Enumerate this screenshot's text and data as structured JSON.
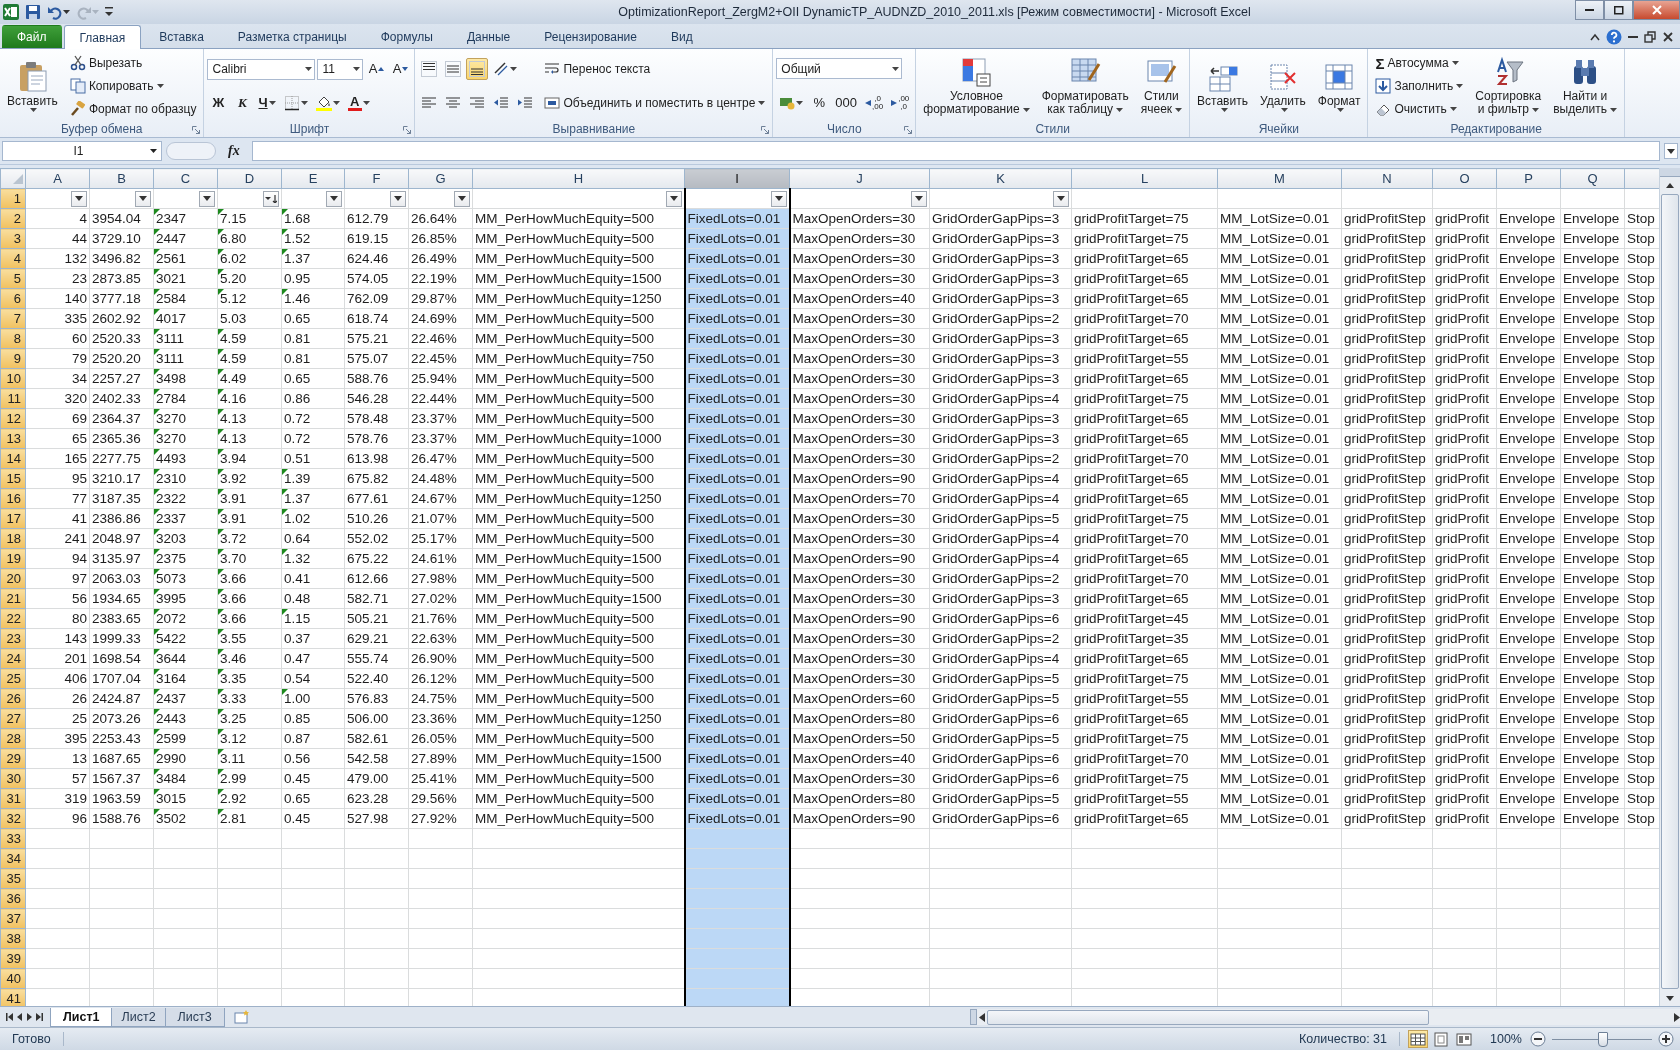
{
  "window": {
    "title": "OptimizationReport_ZergM2+OII DynamicTP_AUDNZD_2010_2011.xls  [Режим совместимости]  -  Microsoft Excel"
  },
  "quick_access": [
    {
      "disabled": false
    },
    {
      "disabled": false
    },
    {
      "disabled": true
    }
  ],
  "ribbon_tabs": [
    {
      "label": "Файл",
      "kind": "file",
      "selected": false
    },
    {
      "label": "Главная",
      "kind": "tab",
      "selected": true
    },
    {
      "label": "Вставка",
      "kind": "tab",
      "selected": false
    },
    {
      "label": "Разметка страницы",
      "kind": "tab",
      "selected": false
    },
    {
      "label": "Формулы",
      "kind": "tab",
      "selected": false
    },
    {
      "label": "Данные",
      "kind": "tab",
      "selected": false
    },
    {
      "label": "Рецензирование",
      "kind": "tab",
      "selected": false
    },
    {
      "label": "Вид",
      "kind": "tab",
      "selected": false
    }
  ],
  "ribbon": {
    "groups": [
      {
        "label": "Буфер обмена",
        "launcher": true,
        "columns": [
          [
            [
              {
                "kind": "large",
                "label": "Вставить",
                "dropdown": true
              }
            ]
          ],
          [
            [
              {
                "kind": "small",
                "label": "Вырезать"
              }
            ],
            [
              {
                "kind": "small",
                "label": "Копировать",
                "dropdown": true
              }
            ],
            [
              {
                "kind": "small",
                "label": "Формат по образцу"
              }
            ]
          ]
        ]
      },
      {
        "label": "Шрифт",
        "launcher": true,
        "columns": [
          [
            [
              {
                "kind": "combo",
                "value": "Calibri"
              },
              {
                "kind": "combo",
                "value": "11"
              },
              {
                "kind": "tool",
                "glyph": "A"
              },
              {
                "kind": "tool",
                "glyph": "A"
              }
            ],
            [
              {
                "kind": "tool",
                "glyph": "Ж"
              },
              {
                "kind": "tool",
                "glyph": "К"
              },
              {
                "kind": "tool",
                "glyph": "Ч",
                "dropdown": true
              },
              {
                "kind": "tool",
                "dropdown": true
              },
              {
                "kind": "tool",
                "dropdown": true
              },
              {
                "kind": "tool",
                "glyph": "A",
                "dropdown": true
              }
            ]
          ]
        ]
      },
      {
        "label": "Выравнивание",
        "launcher": true,
        "columns": [
          [
            [
              {
                "kind": "tool",
                "selected": false
              },
              {
                "kind": "tool",
                "selected": false
              },
              {
                "kind": "tool",
                "selected": true
              },
              {
                "kind": "tool",
                "dropdown": true
              }
            ],
            [
              {
                "kind": "tool",
                "selected": false
              },
              {
                "kind": "tool",
                "selected": false
              },
              {
                "kind": "tool",
                "selected": false
              },
              {
                "kind": "tool"
              },
              {
                "kind": "tool"
              }
            ]
          ],
          [
            [
              {
                "kind": "small",
                "label": "Перенос текста"
              }
            ],
            [
              {
                "kind": "small",
                "label": "Объединить и поместить в центре",
                "dropdown": true
              }
            ]
          ]
        ]
      },
      {
        "label": "Число",
        "launcher": true,
        "columns": [
          [
            [
              {
                "kind": "combo",
                "value": "Общий"
              }
            ],
            [
              {
                "kind": "tool",
                "dropdown": true
              },
              {
                "kind": "tool",
                "glyph": "%"
              },
              {
                "kind": "tool",
                "glyph": "000"
              },
              {
                "kind": "tool",
                "glyph": ",0\n,00"
              },
              {
                "kind": "tool",
                "glyph": ",00\n,0"
              }
            ]
          ]
        ]
      },
      {
        "label": "Стили",
        "launcher": false,
        "columns": [
          [
            [
              {
                "kind": "large",
                "label": "Условное\nформатирование",
                "dropdown": true
              }
            ]
          ],
          [
            [
              {
                "kind": "large",
                "label": "Форматировать\nкак таблицу",
                "dropdown": true
              }
            ]
          ],
          [
            [
              {
                "kind": "large",
                "label": "Стили\nячеек",
                "dropdown": true
              }
            ]
          ]
        ]
      },
      {
        "label": "Ячейки",
        "launcher": false,
        "columns": [
          [
            [
              {
                "kind": "large",
                "label": "Вставить",
                "dropdown": true
              }
            ]
          ],
          [
            [
              {
                "kind": "large",
                "label": "Удалить",
                "dropdown": true
              }
            ]
          ],
          [
            [
              {
                "kind": "large",
                "label": "Формат",
                "dropdown": true
              }
            ]
          ]
        ]
      },
      {
        "label": "Редактирование",
        "launcher": false,
        "columns": [
          [
            [
              {
                "kind": "small",
                "glyph": "Σ",
                "label": "Автосумма",
                "dropdown": true
              }
            ],
            [
              {
                "kind": "small",
                "label": "Заполнить",
                "dropdown": true
              }
            ],
            [
              {
                "kind": "small",
                "label": "Очистить",
                "dropdown": true
              }
            ]
          ],
          [
            [
              {
                "kind": "large",
                "label": "Сортировка\nи фильтр",
                "dropdown": true
              }
            ]
          ],
          [
            [
              {
                "kind": "large",
                "label": "Найти и\nвыделить",
                "dropdown": true
              }
            ]
          ]
        ]
      }
    ]
  },
  "formula_bar": {
    "name_box": "I1",
    "function_label": "fx"
  },
  "sheet": {
    "columns": [
      {
        "letter": "A",
        "kind": "number",
        "filter": true,
        "sorted_desc": false,
        "selected": false
      },
      {
        "letter": "B",
        "kind": "text",
        "filter": true,
        "sorted_desc": false,
        "selected": false
      },
      {
        "letter": "C",
        "kind": "text",
        "filter": true,
        "sorted_desc": false,
        "selected": false
      },
      {
        "letter": "D",
        "kind": "text",
        "filter": true,
        "sorted_desc": true,
        "selected": false
      },
      {
        "letter": "E",
        "kind": "text",
        "filter": true,
        "sorted_desc": false,
        "selected": false
      },
      {
        "letter": "F",
        "kind": "text",
        "filter": true,
        "sorted_desc": false,
        "selected": false
      },
      {
        "letter": "G",
        "kind": "text",
        "filter": true,
        "sorted_desc": false,
        "selected": false
      },
      {
        "letter": "H",
        "kind": "text",
        "filter": true,
        "sorted_desc": false,
        "selected": false
      },
      {
        "letter": "I",
        "kind": "text",
        "filter": true,
        "sorted_desc": false,
        "selected": true
      },
      {
        "letter": "J",
        "kind": "text",
        "filter": true,
        "sorted_desc": false,
        "selected": false
      },
      {
        "letter": "K",
        "kind": "text",
        "filter": true,
        "sorted_desc": false,
        "selected": false
      },
      {
        "letter": "L",
        "kind": "text",
        "filter": false,
        "selected": false
      },
      {
        "letter": "M",
        "kind": "text",
        "filter": false,
        "selected": false
      },
      {
        "letter": "N",
        "kind": "text",
        "filter": false,
        "selected": false
      },
      {
        "letter": "O",
        "kind": "text",
        "filter": false,
        "selected": false
      },
      {
        "letter": "P",
        "kind": "text",
        "filter": false,
        "selected": false
      },
      {
        "letter": "Q",
        "kind": "text",
        "filter": false,
        "selected": false
      },
      {
        "kind": "text",
        "filter": false,
        "selected": false
      }
    ],
    "row_numbers": [
      "1",
      "2",
      "3",
      "4",
      "5",
      "6",
      "7",
      "8",
      "9",
      "10",
      "11",
      "12",
      "13",
      "14",
      "15",
      "16",
      "17",
      "18",
      "19",
      "20",
      "21",
      "22",
      "23",
      "24",
      "25",
      "26",
      "27",
      "28",
      "29",
      "30",
      "31",
      "32",
      "33",
      "34",
      "35",
      "36",
      "37",
      "38",
      "39",
      "40",
      "41"
    ],
    "rows": [
      {
        "cells": [
          "4",
          "3954.04",
          "2347",
          "7.15",
          "1.68",
          "612.79",
          "26.64%",
          "MM_PerHowMuchEquity=500",
          "FixedLots=0.01",
          "MaxOpenOrders=30",
          "GridOrderGapPips=3",
          "gridProfitTarget=75",
          "MM_LotSize=0.01",
          "gridProfitStep",
          "gridProfit",
          "Envelope",
          "Envelope",
          "Stop"
        ],
        "marked": [
          true,
          true,
          true
        ]
      },
      {
        "cells": [
          "44",
          "3729.10",
          "2447",
          "6.80",
          "1.52",
          "619.15",
          "26.85%",
          "MM_PerHowMuchEquity=500",
          "FixedLots=0.01",
          "MaxOpenOrders=30",
          "GridOrderGapPips=3",
          "gridProfitTarget=75",
          "MM_LotSize=0.01",
          "gridProfitStep",
          "gridProfit",
          "Envelope",
          "Envelope",
          "Stop"
        ],
        "marked": [
          true,
          true,
          true
        ]
      },
      {
        "cells": [
          "132",
          "3496.82",
          "2561",
          "6.02",
          "1.37",
          "624.46",
          "26.49%",
          "MM_PerHowMuchEquity=500",
          "FixedLots=0.01",
          "MaxOpenOrders=30",
          "GridOrderGapPips=3",
          "gridProfitTarget=65",
          "MM_LotSize=0.01",
          "gridProfitStep",
          "gridProfit",
          "Envelope",
          "Envelope",
          "Stop"
        ],
        "marked": [
          true,
          true,
          true
        ]
      },
      {
        "cells": [
          "23",
          "2873.85",
          "3021",
          "5.20",
          "0.95",
          "574.05",
          "22.19%",
          "MM_PerHowMuchEquity=1500",
          "FixedLots=0.01",
          "MaxOpenOrders=30",
          "GridOrderGapPips=3",
          "gridProfitTarget=65",
          "MM_LotSize=0.01",
          "gridProfitStep",
          "gridProfit",
          "Envelope",
          "Envelope",
          "Stop"
        ],
        "marked": [
          true,
          true,
          false
        ]
      },
      {
        "cells": [
          "140",
          "3777.18",
          "2584",
          "5.12",
          "1.46",
          "762.09",
          "29.87%",
          "MM_PerHowMuchEquity=1250",
          "FixedLots=0.01",
          "MaxOpenOrders=40",
          "GridOrderGapPips=3",
          "gridProfitTarget=65",
          "MM_LotSize=0.01",
          "gridProfitStep",
          "gridProfit",
          "Envelope",
          "Envelope",
          "Stop"
        ],
        "marked": [
          true,
          true,
          true
        ]
      },
      {
        "cells": [
          "335",
          "2602.92",
          "4017",
          "5.03",
          "0.65",
          "618.74",
          "24.69%",
          "MM_PerHowMuchEquity=500",
          "FixedLots=0.01",
          "MaxOpenOrders=30",
          "GridOrderGapPips=2",
          "gridProfitTarget=70",
          "MM_LotSize=0.01",
          "gridProfitStep",
          "gridProfit",
          "Envelope",
          "Envelope",
          "Stop"
        ],
        "marked": [
          true,
          false,
          false
        ]
      },
      {
        "cells": [
          "60",
          "2520.33",
          "3111",
          "4.59",
          "0.81",
          "575.21",
          "22.46%",
          "MM_PerHowMuchEquity=500",
          "FixedLots=0.01",
          "MaxOpenOrders=30",
          "GridOrderGapPips=3",
          "gridProfitTarget=65",
          "MM_LotSize=0.01",
          "gridProfitStep",
          "gridProfit",
          "Envelope",
          "Envelope",
          "Stop"
        ],
        "marked": [
          true,
          true,
          false
        ]
      },
      {
        "cells": [
          "79",
          "2520.20",
          "3111",
          "4.59",
          "0.81",
          "575.07",
          "22.45%",
          "MM_PerHowMuchEquity=750",
          "FixedLots=0.01",
          "MaxOpenOrders=30",
          "GridOrderGapPips=3",
          "gridProfitTarget=55",
          "MM_LotSize=0.01",
          "gridProfitStep",
          "gridProfit",
          "Envelope",
          "Envelope",
          "Stop"
        ],
        "marked": [
          true,
          true,
          false
        ]
      },
      {
        "cells": [
          "34",
          "2257.27",
          "3498",
          "4.49",
          "0.65",
          "588.76",
          "25.94%",
          "MM_PerHowMuchEquity=500",
          "FixedLots=0.01",
          "MaxOpenOrders=30",
          "GridOrderGapPips=3",
          "gridProfitTarget=65",
          "MM_LotSize=0.01",
          "gridProfitStep",
          "gridProfit",
          "Envelope",
          "Envelope",
          "Stop"
        ],
        "marked": [
          true,
          true,
          false
        ]
      },
      {
        "cells": [
          "320",
          "2402.33",
          "2784",
          "4.16",
          "0.86",
          "546.28",
          "22.44%",
          "MM_PerHowMuchEquity=500",
          "FixedLots=0.01",
          "MaxOpenOrders=30",
          "GridOrderGapPips=4",
          "gridProfitTarget=75",
          "MM_LotSize=0.01",
          "gridProfitStep",
          "gridProfit",
          "Envelope",
          "Envelope",
          "Stop"
        ],
        "marked": [
          true,
          true,
          false
        ]
      },
      {
        "cells": [
          "69",
          "2364.37",
          "3270",
          "4.13",
          "0.72",
          "578.48",
          "23.37%",
          "MM_PerHowMuchEquity=500",
          "FixedLots=0.01",
          "MaxOpenOrders=30",
          "GridOrderGapPips=3",
          "gridProfitTarget=65",
          "MM_LotSize=0.01",
          "gridProfitStep",
          "gridProfit",
          "Envelope",
          "Envelope",
          "Stop"
        ],
        "marked": [
          true,
          true,
          false
        ]
      },
      {
        "cells": [
          "65",
          "2365.36",
          "3270",
          "4.13",
          "0.72",
          "578.76",
          "23.37%",
          "MM_PerHowMuchEquity=1000",
          "FixedLots=0.01",
          "MaxOpenOrders=30",
          "GridOrderGapPips=3",
          "gridProfitTarget=65",
          "MM_LotSize=0.01",
          "gridProfitStep",
          "gridProfit",
          "Envelope",
          "Envelope",
          "Stop"
        ],
        "marked": [
          true,
          true,
          false
        ]
      },
      {
        "cells": [
          "165",
          "2277.75",
          "4493",
          "3.94",
          "0.51",
          "613.98",
          "26.47%",
          "MM_PerHowMuchEquity=500",
          "FixedLots=0.01",
          "MaxOpenOrders=30",
          "GridOrderGapPips=2",
          "gridProfitTarget=70",
          "MM_LotSize=0.01",
          "gridProfitStep",
          "gridProfit",
          "Envelope",
          "Envelope",
          "Stop"
        ],
        "marked": [
          true,
          true,
          false
        ]
      },
      {
        "cells": [
          "95",
          "3210.17",
          "2310",
          "3.92",
          "1.39",
          "675.82",
          "24.48%",
          "MM_PerHowMuchEquity=500",
          "FixedLots=0.01",
          "MaxOpenOrders=90",
          "GridOrderGapPips=4",
          "gridProfitTarget=65",
          "MM_LotSize=0.01",
          "gridProfitStep",
          "gridProfit",
          "Envelope",
          "Envelope",
          "Stop"
        ],
        "marked": [
          true,
          true,
          true
        ]
      },
      {
        "cells": [
          "77",
          "3187.35",
          "2322",
          "3.91",
          "1.37",
          "677.61",
          "24.67%",
          "MM_PerHowMuchEquity=1250",
          "FixedLots=0.01",
          "MaxOpenOrders=70",
          "GridOrderGapPips=4",
          "gridProfitTarget=65",
          "MM_LotSize=0.01",
          "gridProfitStep",
          "gridProfit",
          "Envelope",
          "Envelope",
          "Stop"
        ],
        "marked": [
          true,
          true,
          true
        ]
      },
      {
        "cells": [
          "41",
          "2386.86",
          "2337",
          "3.91",
          "1.02",
          "510.26",
          "21.07%",
          "MM_PerHowMuchEquity=500",
          "FixedLots=0.01",
          "MaxOpenOrders=30",
          "GridOrderGapPips=5",
          "gridProfitTarget=75",
          "MM_LotSize=0.01",
          "gridProfitStep",
          "gridProfit",
          "Envelope",
          "Envelope",
          "Stop"
        ],
        "marked": [
          true,
          true,
          true
        ]
      },
      {
        "cells": [
          "241",
          "2048.97",
          "3203",
          "3.72",
          "0.64",
          "552.02",
          "25.17%",
          "MM_PerHowMuchEquity=500",
          "FixedLots=0.01",
          "MaxOpenOrders=30",
          "GridOrderGapPips=4",
          "gridProfitTarget=70",
          "MM_LotSize=0.01",
          "gridProfitStep",
          "gridProfit",
          "Envelope",
          "Envelope",
          "Stop"
        ],
        "marked": [
          true,
          true,
          false
        ]
      },
      {
        "cells": [
          "94",
          "3135.97",
          "2375",
          "3.70",
          "1.32",
          "675.22",
          "24.61%",
          "MM_PerHowMuchEquity=1500",
          "FixedLots=0.01",
          "MaxOpenOrders=90",
          "GridOrderGapPips=4",
          "gridProfitTarget=65",
          "MM_LotSize=0.01",
          "gridProfitStep",
          "gridProfit",
          "Envelope",
          "Envelope",
          "Stop"
        ],
        "marked": [
          true,
          true,
          true
        ]
      },
      {
        "cells": [
          "97",
          "2063.03",
          "5073",
          "3.66",
          "0.41",
          "612.66",
          "27.98%",
          "MM_PerHowMuchEquity=500",
          "FixedLots=0.01",
          "MaxOpenOrders=30",
          "GridOrderGapPips=2",
          "gridProfitTarget=70",
          "MM_LotSize=0.01",
          "gridProfitStep",
          "gridProfit",
          "Envelope",
          "Envelope",
          "Stop"
        ],
        "marked": [
          true,
          true,
          false
        ]
      },
      {
        "cells": [
          "56",
          "1934.65",
          "3995",
          "3.66",
          "0.48",
          "582.71",
          "27.02%",
          "MM_PerHowMuchEquity=1500",
          "FixedLots=0.01",
          "MaxOpenOrders=30",
          "GridOrderGapPips=3",
          "gridProfitTarget=65",
          "MM_LotSize=0.01",
          "gridProfitStep",
          "gridProfit",
          "Envelope",
          "Envelope",
          "Stop"
        ],
        "marked": [
          true,
          true,
          false
        ]
      },
      {
        "cells": [
          "80",
          "2383.65",
          "2072",
          "3.66",
          "1.15",
          "505.21",
          "21.76%",
          "MM_PerHowMuchEquity=500",
          "FixedLots=0.01",
          "MaxOpenOrders=90",
          "GridOrderGapPips=6",
          "gridProfitTarget=45",
          "MM_LotSize=0.01",
          "gridProfitStep",
          "gridProfit",
          "Envelope",
          "Envelope",
          "Stop"
        ],
        "marked": [
          true,
          true,
          true
        ]
      },
      {
        "cells": [
          "143",
          "1999.33",
          "5422",
          "3.55",
          "0.37",
          "629.21",
          "22.63%",
          "MM_PerHowMuchEquity=500",
          "FixedLots=0.01",
          "MaxOpenOrders=30",
          "GridOrderGapPips=2",
          "gridProfitTarget=35",
          "MM_LotSize=0.01",
          "gridProfitStep",
          "gridProfit",
          "Envelope",
          "Envelope",
          "Stop"
        ],
        "marked": [
          true,
          true,
          false
        ]
      },
      {
        "cells": [
          "201",
          "1698.54",
          "3644",
          "3.46",
          "0.47",
          "555.74",
          "26.90%",
          "MM_PerHowMuchEquity=500",
          "FixedLots=0.01",
          "MaxOpenOrders=30",
          "GridOrderGapPips=4",
          "gridProfitTarget=65",
          "MM_LotSize=0.01",
          "gridProfitStep",
          "gridProfit",
          "Envelope",
          "Envelope",
          "Stop"
        ],
        "marked": [
          true,
          true,
          false
        ]
      },
      {
        "cells": [
          "406",
          "1707.04",
          "3164",
          "3.35",
          "0.54",
          "522.40",
          "26.12%",
          "MM_PerHowMuchEquity=500",
          "FixedLots=0.01",
          "MaxOpenOrders=30",
          "GridOrderGapPips=5",
          "gridProfitTarget=75",
          "MM_LotSize=0.01",
          "gridProfitStep",
          "gridProfit",
          "Envelope",
          "Envelope",
          "Stop"
        ],
        "marked": [
          true,
          true,
          false
        ]
      },
      {
        "cells": [
          "26",
          "2424.87",
          "2437",
          "3.33",
          "1.00",
          "576.83",
          "24.75%",
          "MM_PerHowMuchEquity=500",
          "FixedLots=0.01",
          "MaxOpenOrders=60",
          "GridOrderGapPips=5",
          "gridProfitTarget=55",
          "MM_LotSize=0.01",
          "gridProfitStep",
          "gridProfit",
          "Envelope",
          "Envelope",
          "Stop"
        ],
        "marked": [
          true,
          true,
          true
        ]
      },
      {
        "cells": [
          "25",
          "2073.26",
          "2443",
          "3.25",
          "0.85",
          "506.00",
          "23.36%",
          "MM_PerHowMuchEquity=1250",
          "FixedLots=0.01",
          "MaxOpenOrders=80",
          "GridOrderGapPips=6",
          "gridProfitTarget=65",
          "MM_LotSize=0.01",
          "gridProfitStep",
          "gridProfit",
          "Envelope",
          "Envelope",
          "Stop"
        ],
        "marked": [
          true,
          true,
          false
        ]
      },
      {
        "cells": [
          "395",
          "2253.43",
          "2599",
          "3.12",
          "0.87",
          "582.61",
          "26.05%",
          "MM_PerHowMuchEquity=500",
          "FixedLots=0.01",
          "MaxOpenOrders=50",
          "GridOrderGapPips=5",
          "gridProfitTarget=75",
          "MM_LotSize=0.01",
          "gridProfitStep",
          "gridProfit",
          "Envelope",
          "Envelope",
          "Stop"
        ],
        "marked": [
          true,
          true,
          false
        ]
      },
      {
        "cells": [
          "13",
          "1687.65",
          "2990",
          "3.11",
          "0.56",
          "542.58",
          "27.89%",
          "MM_PerHowMuchEquity=1500",
          "FixedLots=0.01",
          "MaxOpenOrders=40",
          "GridOrderGapPips=6",
          "gridProfitTarget=70",
          "MM_LotSize=0.01",
          "gridProfitStep",
          "gridProfit",
          "Envelope",
          "Envelope",
          "Stop"
        ],
        "marked": [
          true,
          true,
          false
        ]
      },
      {
        "cells": [
          "57",
          "1567.37",
          "3484",
          "2.99",
          "0.45",
          "479.00",
          "25.41%",
          "MM_PerHowMuchEquity=500",
          "FixedLots=0.01",
          "MaxOpenOrders=30",
          "GridOrderGapPips=6",
          "gridProfitTarget=75",
          "MM_LotSize=0.01",
          "gridProfitStep",
          "gridProfit",
          "Envelope",
          "Envelope",
          "Stop"
        ],
        "marked": [
          true,
          true,
          false
        ]
      },
      {
        "cells": [
          "319",
          "1963.59",
          "3015",
          "2.92",
          "0.65",
          "623.28",
          "29.56%",
          "MM_PerHowMuchEquity=500",
          "FixedLots=0.01",
          "MaxOpenOrders=80",
          "GridOrderGapPips=5",
          "gridProfitTarget=55",
          "MM_LotSize=0.01",
          "gridProfitStep",
          "gridProfit",
          "Envelope",
          "Envelope",
          "Stop"
        ],
        "marked": [
          true,
          true,
          false
        ]
      },
      {
        "cells": [
          "96",
          "1588.76",
          "3502",
          "2.81",
          "0.45",
          "527.98",
          "27.92%",
          "MM_PerHowMuchEquity=500",
          "FixedLots=0.01",
          "MaxOpenOrders=90",
          "GridOrderGapPips=6",
          "gridProfitTarget=65",
          "MM_LotSize=0.01",
          "gridProfitStep",
          "gridProfit",
          "Envelope",
          "Envelope",
          "Stop"
        ],
        "marked": [
          true,
          true,
          false
        ]
      }
    ]
  },
  "sheet_tabs": [
    {
      "label": "Лист1",
      "selected": true
    },
    {
      "label": "Лист2",
      "selected": false
    },
    {
      "label": "Лист3",
      "selected": false
    }
  ],
  "status_bar": {
    "mode": "Готово",
    "summary": "Количество: 31",
    "views": [
      {
        "selected": true
      },
      {
        "selected": false
      },
      {
        "selected": false
      }
    ],
    "zoom": "100%",
    "zoom_slider": {
      "level": 0.5
    }
  }
}
